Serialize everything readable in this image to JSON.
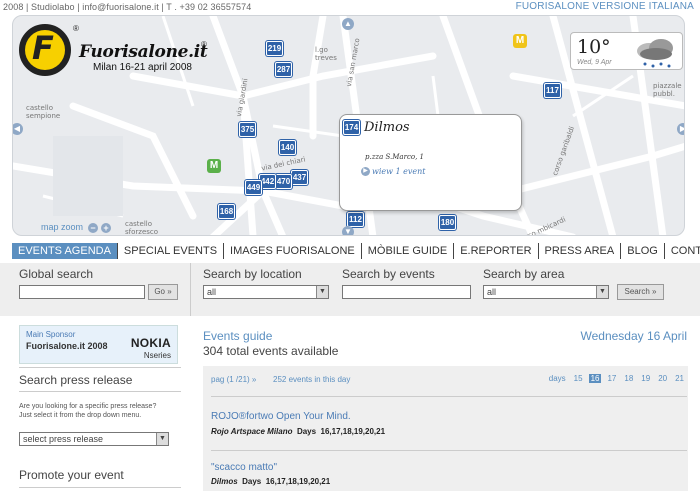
{
  "topbar": {
    "left_text": "2008 | Studiolabo | info@fuorisalone.it | T . +39 02 36557574",
    "right_link": "FUORISALONE VERSIONE ITALIANA"
  },
  "logo": {
    "letter": "F",
    "wordmark": "Fuorisalone.it",
    "registered": "®",
    "tagline": "Milan  16-21 april 2008"
  },
  "map": {
    "pins": [
      "219",
      "287",
      "117",
      "375",
      "140",
      "174",
      "437",
      "470",
      "442",
      "449",
      "168",
      "112",
      "180"
    ],
    "metro_labels": [
      "M",
      "M"
    ],
    "streets": [
      "l.go treves",
      "via san marco",
      "via giardini",
      "via dei chiari",
      "castello sempione",
      "castello sforzesco",
      "corso garibaldi",
      "corso mbicardi",
      "piazzale pubbl."
    ],
    "zoom_label": "map zoom",
    "zoom_out": "−",
    "zoom_in": "+",
    "popup": {
      "pin": "174",
      "name": "Dilmos",
      "address": "p.zza S.Marco, 1",
      "link": "wiew 1 event"
    },
    "weather": {
      "temp": "10°",
      "date": "Wed, 9 Apr",
      "icon": "cloud-rain-icon"
    }
  },
  "nav": {
    "items": [
      "EVENTS AGENDA",
      "SPECIAL EVENTS",
      "IMAGES FUORISALONE",
      "MÒBILE GUIDE",
      "E.REPORTER",
      "PRESS AREA",
      "BLOG",
      "CONTACTS"
    ],
    "active_index": 0
  },
  "search": {
    "global_label": "Global search",
    "global_value": "",
    "go_label": "Go »",
    "location_label": "Search by location",
    "location_value": "all",
    "events_label": "Search by events",
    "events_value": "",
    "area_label": "Search by area",
    "area_value": "all",
    "search_button": "Search »"
  },
  "sponsor": {
    "main_label": "Main Sponsor",
    "site": "Fuorisalone.it 2008",
    "brand": "NOKIA",
    "series": "Nseries"
  },
  "press": {
    "heading": "Search press release",
    "help": "Are you looking for a specific press release?\nJust select it from the drop down menu.",
    "select_value": "select press release"
  },
  "promote": {
    "heading": "Promote your event"
  },
  "guide": {
    "title": "Events guide",
    "total": "304 total events available",
    "date": "Wednesday 16 April",
    "pagination": "pag (1 /21) »",
    "count": "252 events in this day",
    "days_label": "days",
    "days": [
      "15",
      "16",
      "17",
      "18",
      "19",
      "20",
      "21"
    ],
    "current_day": "16",
    "events": [
      {
        "title": "ROJO®fortwo Open Your Mind.",
        "venue": "Rojo Artspace Milano",
        "days_label": "Days",
        "days": "16,17,18,19,20,21"
      },
      {
        "title": "\"scacco matto\"",
        "venue": "Dilmos",
        "days_label": "Days",
        "days": "16,17,18,19,20,21"
      }
    ]
  },
  "colors": {
    "accent": "#5b8fc0",
    "pin": "#2f62a8",
    "logo_yellow": "#f7d000",
    "metro_yellow": "#f0c419",
    "metro_green": "#5bb04a"
  }
}
